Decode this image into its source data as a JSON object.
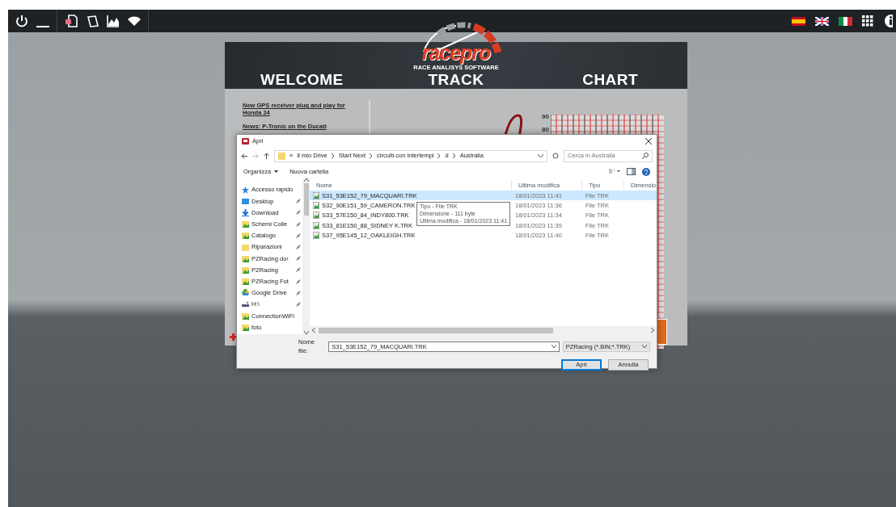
{
  "app": {
    "logo": {
      "brand": "racepro",
      "tagline": "RACE ANALISYS SOFTWARE"
    },
    "sections": [
      "WELCOME",
      "TRACK",
      "CHART"
    ],
    "news": [
      "New GPS receiver plug and play for Honda 24",
      "News: P-Tronic on the Ducati"
    ],
    "chart_ticks": [
      "90",
      "80"
    ]
  },
  "dialog": {
    "title": "Apri",
    "path_prefix": "«",
    "path": [
      "Il mio Drive",
      "Start Next",
      "circuiti con intertempi",
      "d",
      "Australia"
    ],
    "search": {
      "placeholder": "Cerca in Australia"
    },
    "commands": [
      "Organizza",
      "Nuova cartella"
    ],
    "nav": [
      {
        "label": "Accesso rapido",
        "kind": "star",
        "pinned": false
      },
      {
        "label": "Desktop",
        "kind": "desktop",
        "pinned": true
      },
      {
        "label": "Download",
        "kind": "download",
        "pinned": true
      },
      {
        "label": "Schemi Colle",
        "kind": "greenfolder",
        "pinned": true
      },
      {
        "label": "Catalogo",
        "kind": "greenfolder",
        "pinned": true
      },
      {
        "label": "Riparazioni",
        "kind": "folder",
        "pinned": true
      },
      {
        "label": "PZRacing do‹",
        "kind": "greenfolder",
        "pinned": true
      },
      {
        "label": "PZRacing",
        "kind": "greenfolder",
        "pinned": true
      },
      {
        "label": "PZRacing Fot",
        "kind": "greenfolder",
        "pinned": true
      },
      {
        "label": "Google Drive",
        "kind": "gdrive",
        "pinned": true
      },
      {
        "label": "H:\\",
        "kind": "drive",
        "pinned": true
      },
      {
        "label": "ConnectionWiFi",
        "kind": "greenfolder",
        "pinned": false
      },
      {
        "label": "foto",
        "kind": "greenfolder",
        "pinned": false
      }
    ],
    "columns": [
      "Nome",
      "Ultima modifica",
      "Tipo",
      "Dimensio"
    ],
    "files": [
      {
        "name": "S31_53E152_79_MACQUARI.TRK",
        "modified": "18/01/2023 11:41",
        "type": "File TRK",
        "selected": true
      },
      {
        "name": "S32_90E151_59_CAMERON.TRK",
        "modified": "18/01/2023 11:36",
        "type": "File TRK",
        "selected": false
      },
      {
        "name": "S33_57E150_84_INDY800.TRK",
        "modified": "18/01/2023 11:34",
        "type": "File TRK",
        "selected": false
      },
      {
        "name": "S33_81E150_88_SIDNEY K.TRK",
        "modified": "18/01/2023 11:39",
        "type": "File TRK",
        "selected": false
      },
      {
        "name": "S37_95E145_12_OAKLEIGH.TRK",
        "modified": "18/01/2023 11:40",
        "type": "File TRK",
        "selected": false
      }
    ],
    "tooltip": [
      "Tipo - File TRK",
      "Dimensione - 111 byte",
      "Ultima modifica - 18/01/2023 11:41"
    ],
    "filename": {
      "label": "Nome file:",
      "value": "S31_53E152_79_MACQUARI.TRK"
    },
    "filter": "PZRacing (*.BIN;*.TRK)",
    "buttons": [
      "Apri",
      "Annulla"
    ]
  }
}
